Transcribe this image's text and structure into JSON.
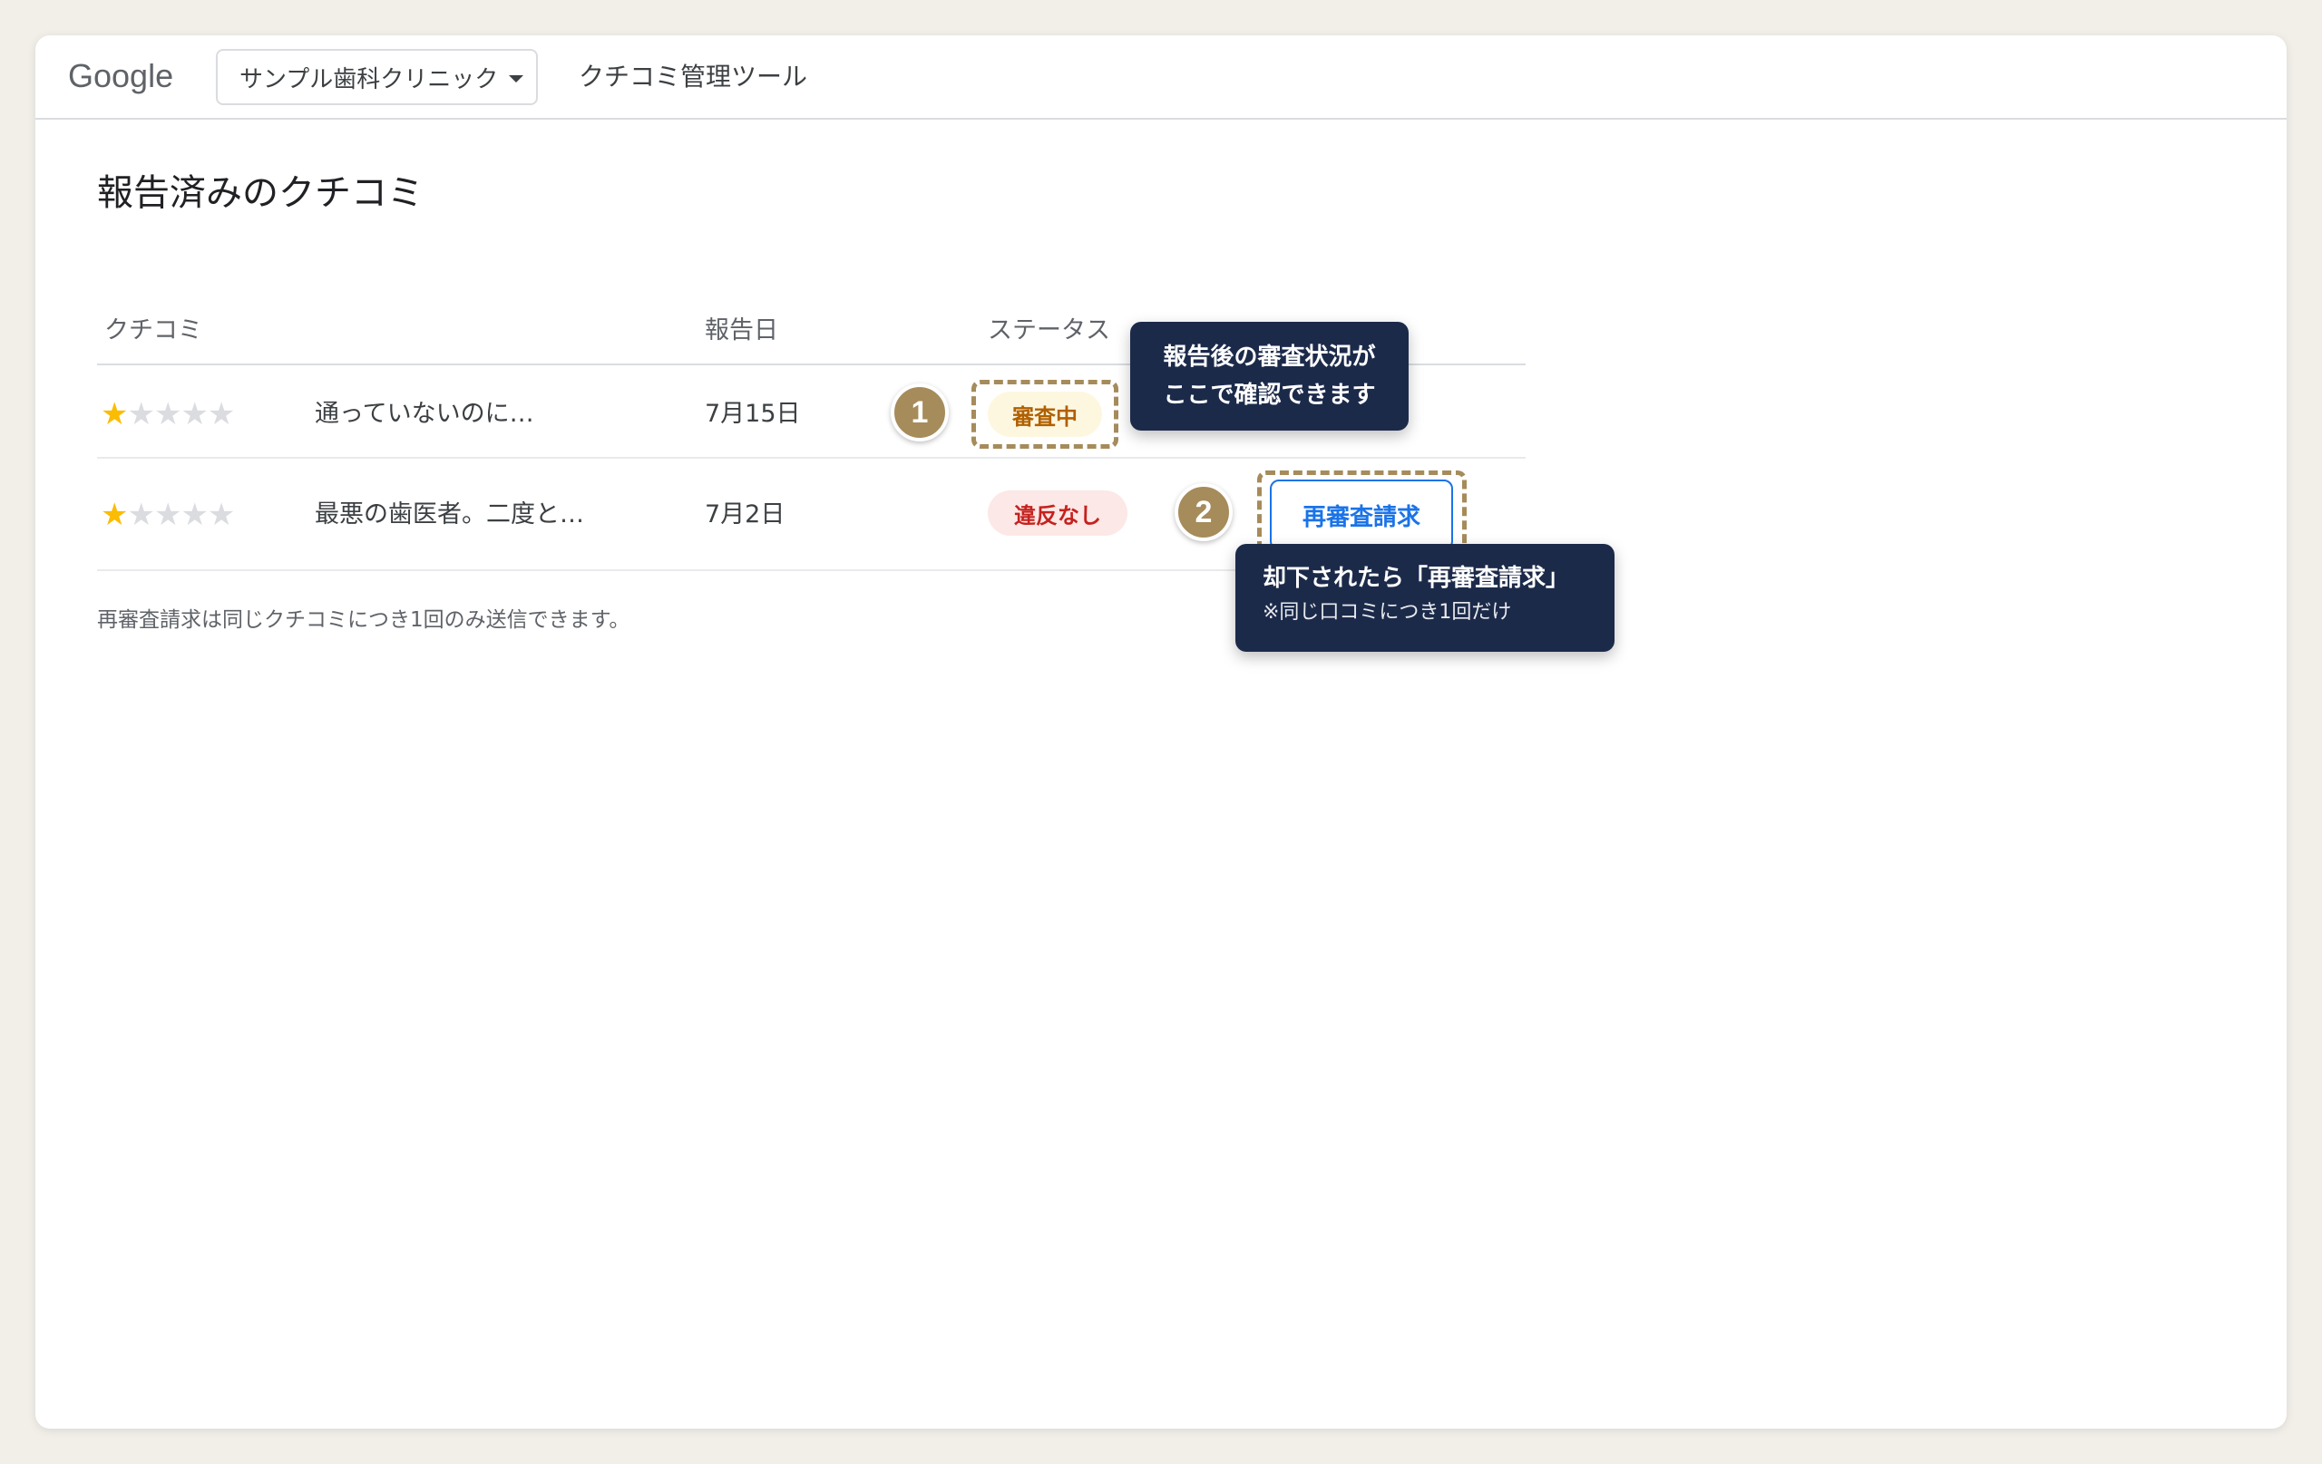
{
  "header": {
    "logo": "Google",
    "business_name": "サンプル歯科クリニック",
    "tool_name": "クチコミ管理ツール"
  },
  "page": {
    "title": "報告済みのクチコミ"
  },
  "table": {
    "columns": [
      "クチコミ",
      "報告日",
      "ステータス"
    ],
    "rows": [
      {
        "rating": 1,
        "max_rating": 5,
        "stars_on": "★",
        "stars_off": "★★★★",
        "review": "通っていないのに…",
        "date": "7月15日",
        "status": "審査中"
      },
      {
        "rating": 1,
        "max_rating": 5,
        "stars_on": "★",
        "stars_off": "★★★★",
        "review": "最悪の歯医者。二度と…",
        "date": "7月2日",
        "status": "違反なし",
        "action": "再審査請求"
      }
    ]
  },
  "footnote": "再審査請求は同じクチコミにつき1回のみ送信できます。",
  "callouts": [
    {
      "number": "1",
      "lines": [
        "報告後の審査状況が",
        "ここで確認できます"
      ]
    },
    {
      "number": "2",
      "title": "却下されたら「再審査請求」",
      "subtitle": "※同じ口コミにつき1回だけ"
    }
  ],
  "colors": {
    "accent_blue": "#1a73e8",
    "star": "#fbbc04",
    "callout": "#a68b5b",
    "tooltip_bg": "#1c2a4a",
    "pending_bg": "#fef7e0",
    "pending_text": "#b06000",
    "rejected_bg": "#fce8e6",
    "rejected_text": "#c5221f"
  }
}
